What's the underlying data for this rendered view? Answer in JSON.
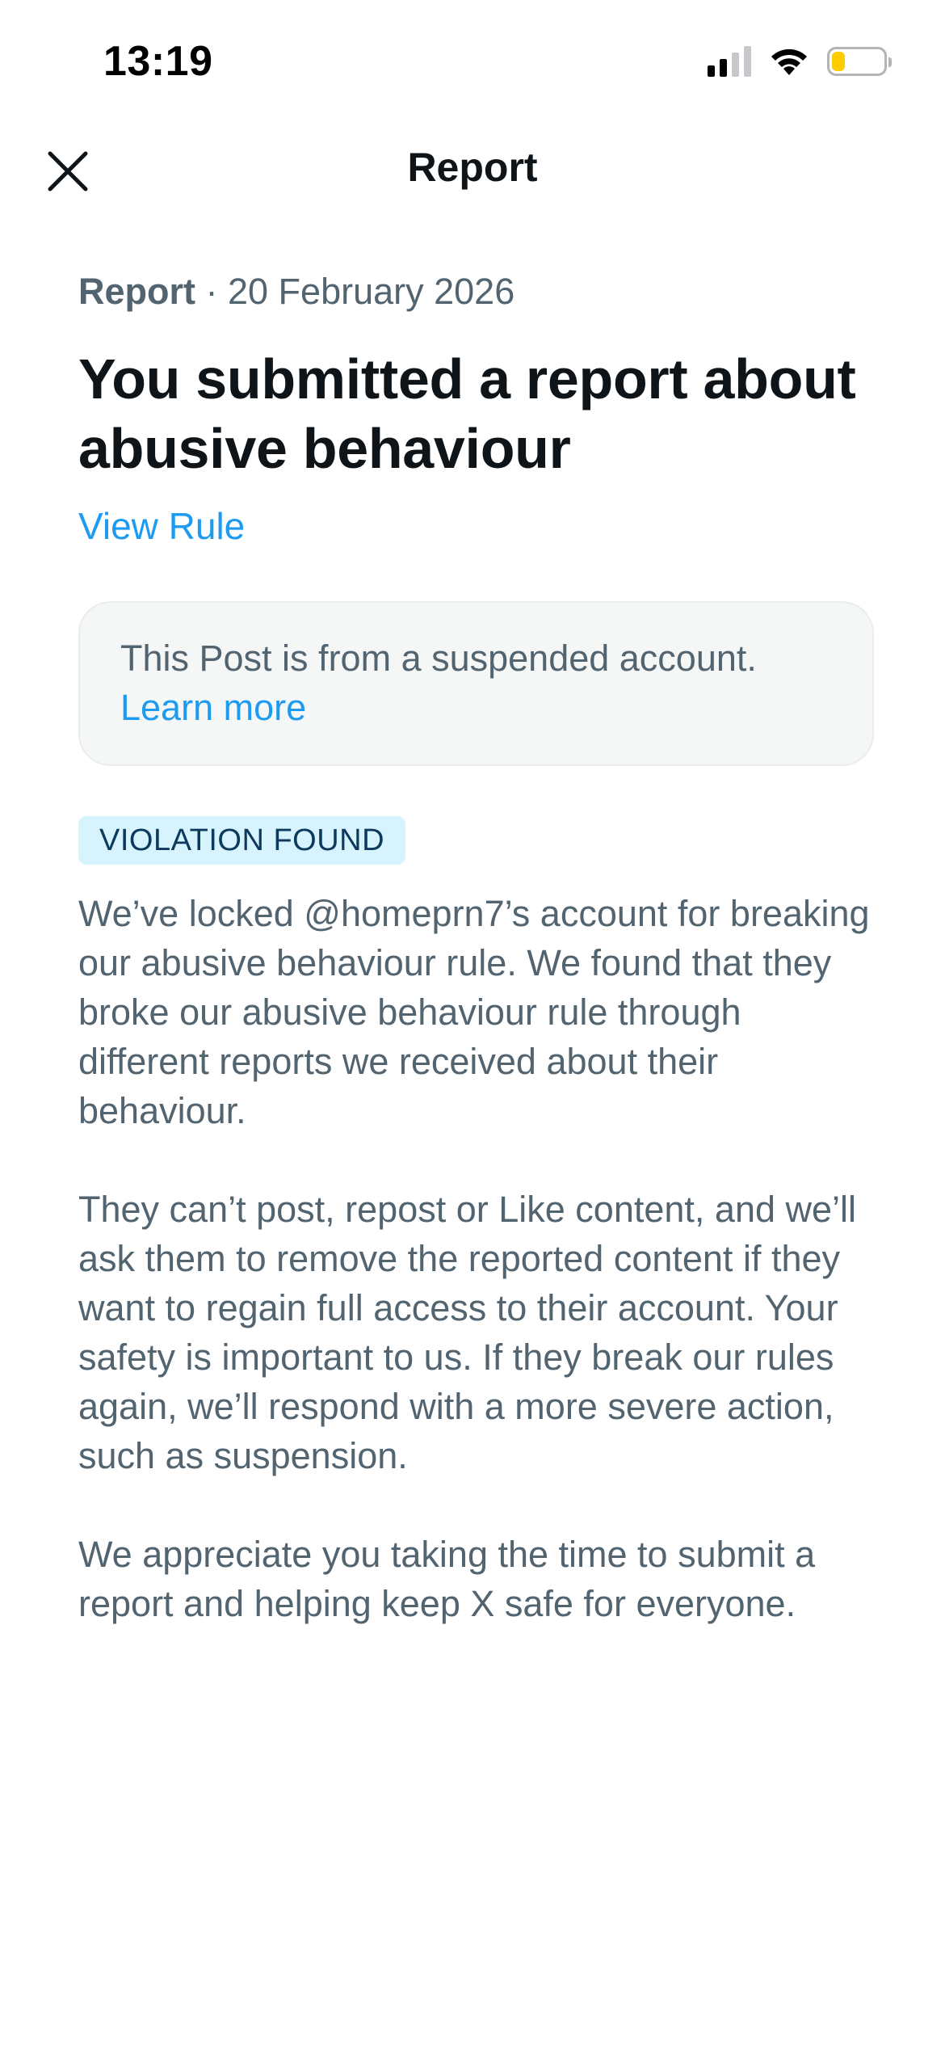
{
  "status_bar": {
    "time": "13:19",
    "icons": [
      "cellular-signal-icon",
      "wifi-icon",
      "battery-icon"
    ],
    "battery_level": 0.25,
    "battery_color": "#ffcc00"
  },
  "header": {
    "title": "Report",
    "close_icon": "close-icon"
  },
  "report": {
    "label": "Report",
    "separator": " · ",
    "date": "20 February 2026",
    "headline": "You submitted a report about abusive behaviour",
    "view_rule_link": "View Rule"
  },
  "notice": {
    "text": "This Post is from a suspended account.",
    "link": "Learn more"
  },
  "status_badge": "VIOLATION FOUND",
  "body": {
    "paragraphs": [
      "We’ve locked @homeprn7’s account for breaking our abusive behaviour rule. We found that they broke our abusive behaviour rule through different reports we received about their behaviour.",
      "They can’t post, repost or Like content, and we’ll ask them to remove the reported content if they want to regain full access to their account. Your safety is important to us. If they break our rules again, we’ll respond with a more severe action, such as suspension.",
      "We appreciate you taking the time to submit a report and helping keep X safe for everyone."
    ]
  },
  "colors": {
    "link": "#1d9bf0",
    "secondary_text": "#536471",
    "primary_text": "#0f1419",
    "badge_background": "#d7f3fd",
    "badge_text": "#0b3a5d",
    "notice_background": "#f5f7f7"
  }
}
